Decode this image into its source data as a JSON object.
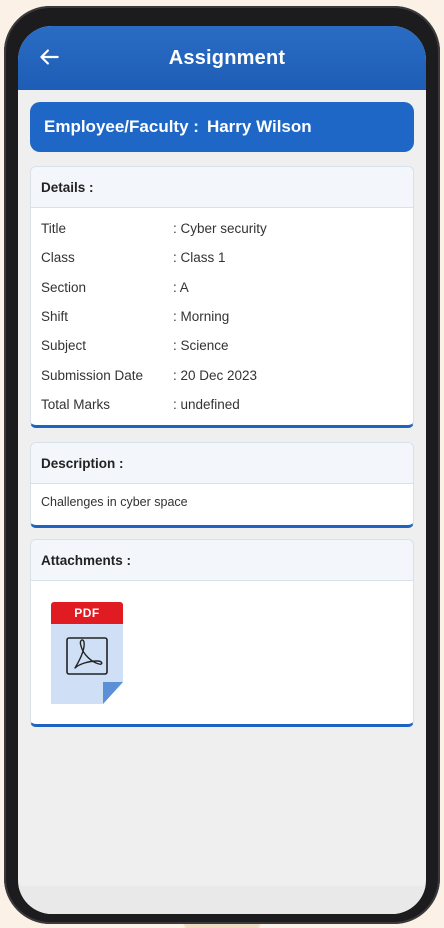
{
  "appbar": {
    "title": "Assignment"
  },
  "employee": {
    "label": "Employee/Faculty :",
    "name": "Harry  Wilson"
  },
  "details": {
    "heading": "Details :",
    "rows": [
      {
        "key": "Title",
        "value": ": Cyber security"
      },
      {
        "key": "Class",
        "value": ": Class 1"
      },
      {
        "key": "Section",
        "value": ": A"
      },
      {
        "key": "Shift",
        "value": ": Morning"
      },
      {
        "key": "Subject",
        "value": ": Science"
      },
      {
        "key": "Submission Date",
        "value": ": 20 Dec 2023"
      },
      {
        "key": "Total Marks",
        "value": ": undefined"
      }
    ]
  },
  "description": {
    "heading": "Description :",
    "text": "Challenges in cyber space"
  },
  "attachments": {
    "heading": "Attachments :",
    "file_badge": "PDF"
  },
  "colors": {
    "primary": "#1e63c2",
    "pdf_red": "#e11b22",
    "pdf_body": "#cfe0f6"
  },
  "icons": {
    "back": "arrow-left-icon",
    "file": "pdf-file-icon"
  }
}
